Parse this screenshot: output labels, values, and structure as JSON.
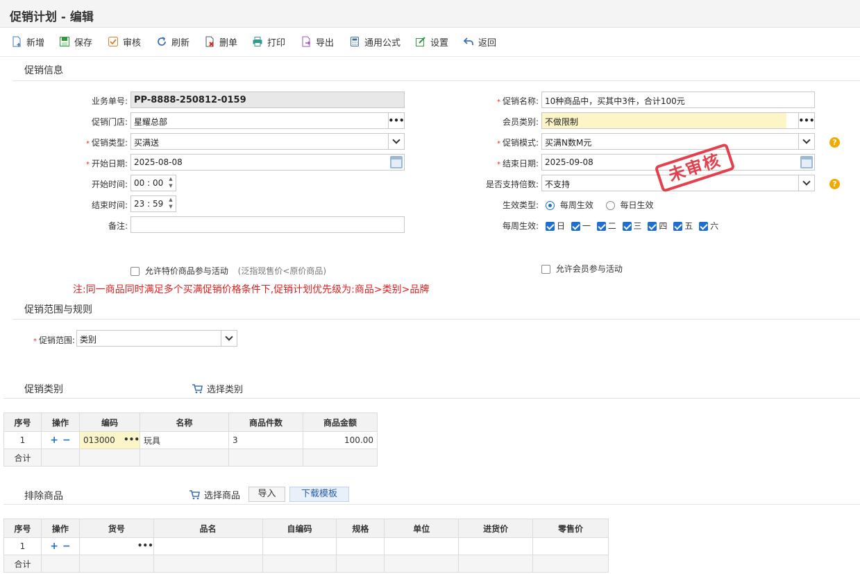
{
  "window": {
    "title": "促销计划 - 编辑"
  },
  "toolbar": {
    "new": "新增",
    "save": "保存",
    "audit": "审核",
    "refresh": "刷新",
    "delete": "删单",
    "print": "打印",
    "export": "导出",
    "formula": "通用公式",
    "settings": "设置",
    "back": "返回"
  },
  "sections": {
    "info": "促销信息",
    "scope": "促销范围与规则",
    "category": "促销类别",
    "exclude": "排除商品"
  },
  "form": {
    "order_no": {
      "label": "业务单号:",
      "value": "PP-8888-250812-0159"
    },
    "store": {
      "label": "促销门店:",
      "value": "星耀总部"
    },
    "type": {
      "label": "促销类型:",
      "value": "买满送"
    },
    "start_date": {
      "label": "开始日期:",
      "value": "2025-08-08"
    },
    "start_time": {
      "label": "开始时间:",
      "value": "00 : 00"
    },
    "end_time": {
      "label": "结束时间:",
      "value": "23 : 59"
    },
    "remark": {
      "label": "备注:",
      "value": ""
    },
    "name": {
      "label": "促销名称:",
      "value": "10种商品中，买其中3件，合计100元"
    },
    "member_type": {
      "label": "会员类别:",
      "value": "不做限制"
    },
    "mode": {
      "label": "促销模式:",
      "value": "买满N数M元"
    },
    "end_date": {
      "label": "结束日期:",
      "value": "2025-09-08"
    },
    "multiple": {
      "label": "是否支持倍数:",
      "value": "不支持"
    },
    "effect_type": {
      "label": "生效类型:",
      "weekly": "每周生效",
      "daily": "每日生效"
    },
    "weekly": {
      "label": "每周生效:",
      "days": [
        "日",
        "一",
        "二",
        "三",
        "四",
        "五",
        "六"
      ]
    },
    "allow_special": "允许特价商品参与活动",
    "allow_special_note": "(泛指现售价<原价商品)",
    "allow_member": "允许会员参与活动",
    "notice": "注:同一商品同时满足多个买满促销价格条件下,促销计划优先级为:商品>类别>品牌",
    "scope": {
      "label": "促销范围:",
      "value": "类别"
    }
  },
  "stamp": "未审核",
  "category_table": {
    "select_label": "选择类别",
    "headers": [
      "序号",
      "操作",
      "编码",
      "名称",
      "商品件数",
      "商品金额"
    ],
    "rows": [
      {
        "no": "1",
        "code": "013000",
        "name": "玩具",
        "qty": "3",
        "amount": "100.00"
      }
    ],
    "total_label": "合计"
  },
  "exclude_table": {
    "select_label": "选择商品",
    "import_label": "导入",
    "download_label": "下载模板",
    "headers": [
      "序号",
      "操作",
      "货号",
      "品名",
      "自编码",
      "规格",
      "单位",
      "进货价",
      "零售价"
    ],
    "rows": [
      {
        "no": "1"
      }
    ],
    "total_label": "合计"
  }
}
